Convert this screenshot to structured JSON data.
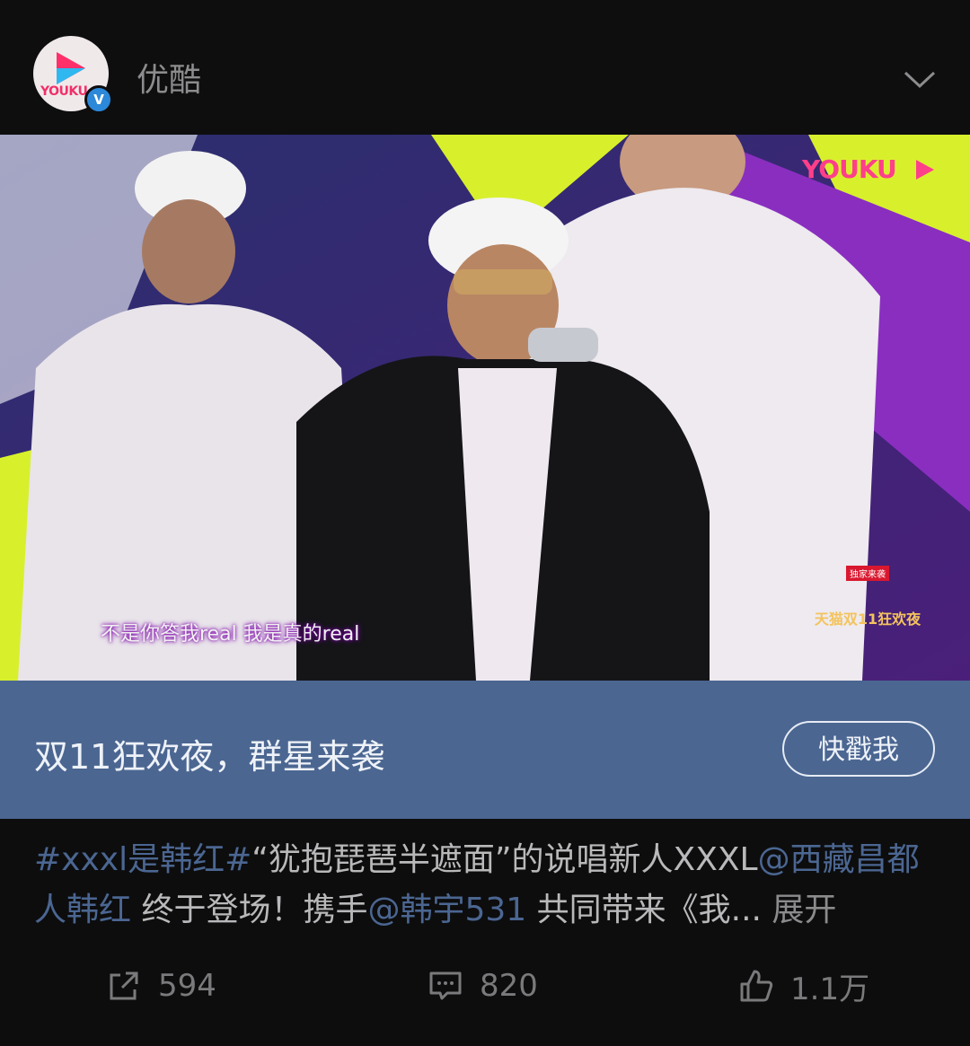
{
  "header": {
    "account_name": "优酷",
    "avatar_logo_text": "YOUKU",
    "verified_badge": "V",
    "icons": {
      "avatar": "youku-logo-icon",
      "expand": "chevron-down-icon"
    }
  },
  "video": {
    "watermark": "YOUKU",
    "subtitle": "不是你答我real 我是真的real",
    "event_logo_tag": "独家来袭",
    "event_logo_name": "天猫双11狂欢夜"
  },
  "promo": {
    "title": "双11狂欢夜，群星来袭",
    "button_label": "快戳我",
    "background_color": "#4b6691"
  },
  "post": {
    "hashtag": "#xxxl是韩红#",
    "text1": "“犹抱琵琶半遮面”的说唱新人XXXL",
    "mention1": "@西藏昌都人韩红",
    "text2": " 终于登场！携手",
    "mention2": "@韩宇531",
    "text3": " 共同带来《我...",
    "more_label": " 展开"
  },
  "actions": {
    "share_count": "594",
    "comment_count": "820",
    "like_count": "1.1万",
    "icons": {
      "share": "share-icon",
      "comment": "comment-icon",
      "like": "thumbs-up-icon"
    }
  }
}
